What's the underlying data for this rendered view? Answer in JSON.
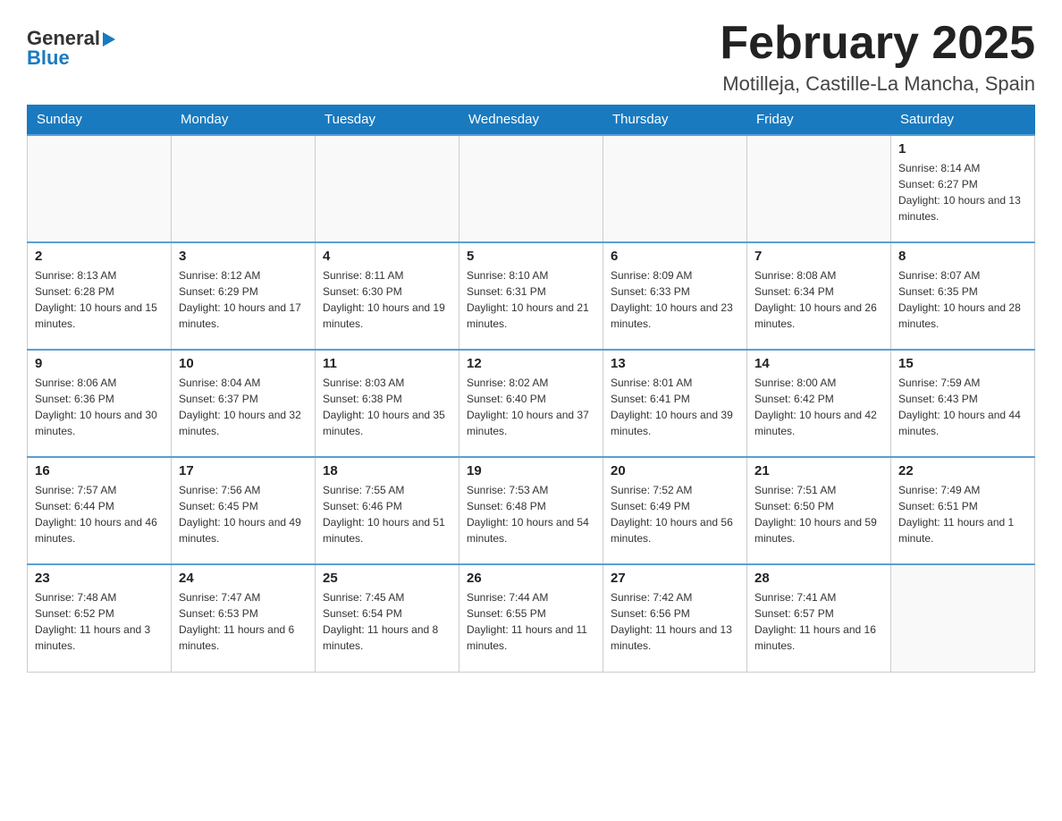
{
  "header": {
    "logo_text_general": "General",
    "logo_text_blue": "Blue",
    "month_title": "February 2025",
    "location": "Motilleja, Castille-La Mancha, Spain"
  },
  "calendar": {
    "days_of_week": [
      "Sunday",
      "Monday",
      "Tuesday",
      "Wednesday",
      "Thursday",
      "Friday",
      "Saturday"
    ],
    "weeks": [
      [
        {
          "day": "",
          "info": ""
        },
        {
          "day": "",
          "info": ""
        },
        {
          "day": "",
          "info": ""
        },
        {
          "day": "",
          "info": ""
        },
        {
          "day": "",
          "info": ""
        },
        {
          "day": "",
          "info": ""
        },
        {
          "day": "1",
          "info": "Sunrise: 8:14 AM\nSunset: 6:27 PM\nDaylight: 10 hours and 13 minutes."
        }
      ],
      [
        {
          "day": "2",
          "info": "Sunrise: 8:13 AM\nSunset: 6:28 PM\nDaylight: 10 hours and 15 minutes."
        },
        {
          "day": "3",
          "info": "Sunrise: 8:12 AM\nSunset: 6:29 PM\nDaylight: 10 hours and 17 minutes."
        },
        {
          "day": "4",
          "info": "Sunrise: 8:11 AM\nSunset: 6:30 PM\nDaylight: 10 hours and 19 minutes."
        },
        {
          "day": "5",
          "info": "Sunrise: 8:10 AM\nSunset: 6:31 PM\nDaylight: 10 hours and 21 minutes."
        },
        {
          "day": "6",
          "info": "Sunrise: 8:09 AM\nSunset: 6:33 PM\nDaylight: 10 hours and 23 minutes."
        },
        {
          "day": "7",
          "info": "Sunrise: 8:08 AM\nSunset: 6:34 PM\nDaylight: 10 hours and 26 minutes."
        },
        {
          "day": "8",
          "info": "Sunrise: 8:07 AM\nSunset: 6:35 PM\nDaylight: 10 hours and 28 minutes."
        }
      ],
      [
        {
          "day": "9",
          "info": "Sunrise: 8:06 AM\nSunset: 6:36 PM\nDaylight: 10 hours and 30 minutes."
        },
        {
          "day": "10",
          "info": "Sunrise: 8:04 AM\nSunset: 6:37 PM\nDaylight: 10 hours and 32 minutes."
        },
        {
          "day": "11",
          "info": "Sunrise: 8:03 AM\nSunset: 6:38 PM\nDaylight: 10 hours and 35 minutes."
        },
        {
          "day": "12",
          "info": "Sunrise: 8:02 AM\nSunset: 6:40 PM\nDaylight: 10 hours and 37 minutes."
        },
        {
          "day": "13",
          "info": "Sunrise: 8:01 AM\nSunset: 6:41 PM\nDaylight: 10 hours and 39 minutes."
        },
        {
          "day": "14",
          "info": "Sunrise: 8:00 AM\nSunset: 6:42 PM\nDaylight: 10 hours and 42 minutes."
        },
        {
          "day": "15",
          "info": "Sunrise: 7:59 AM\nSunset: 6:43 PM\nDaylight: 10 hours and 44 minutes."
        }
      ],
      [
        {
          "day": "16",
          "info": "Sunrise: 7:57 AM\nSunset: 6:44 PM\nDaylight: 10 hours and 46 minutes."
        },
        {
          "day": "17",
          "info": "Sunrise: 7:56 AM\nSunset: 6:45 PM\nDaylight: 10 hours and 49 minutes."
        },
        {
          "day": "18",
          "info": "Sunrise: 7:55 AM\nSunset: 6:46 PM\nDaylight: 10 hours and 51 minutes."
        },
        {
          "day": "19",
          "info": "Sunrise: 7:53 AM\nSunset: 6:48 PM\nDaylight: 10 hours and 54 minutes."
        },
        {
          "day": "20",
          "info": "Sunrise: 7:52 AM\nSunset: 6:49 PM\nDaylight: 10 hours and 56 minutes."
        },
        {
          "day": "21",
          "info": "Sunrise: 7:51 AM\nSunset: 6:50 PM\nDaylight: 10 hours and 59 minutes."
        },
        {
          "day": "22",
          "info": "Sunrise: 7:49 AM\nSunset: 6:51 PM\nDaylight: 11 hours and 1 minute."
        }
      ],
      [
        {
          "day": "23",
          "info": "Sunrise: 7:48 AM\nSunset: 6:52 PM\nDaylight: 11 hours and 3 minutes."
        },
        {
          "day": "24",
          "info": "Sunrise: 7:47 AM\nSunset: 6:53 PM\nDaylight: 11 hours and 6 minutes."
        },
        {
          "day": "25",
          "info": "Sunrise: 7:45 AM\nSunset: 6:54 PM\nDaylight: 11 hours and 8 minutes."
        },
        {
          "day": "26",
          "info": "Sunrise: 7:44 AM\nSunset: 6:55 PM\nDaylight: 11 hours and 11 minutes."
        },
        {
          "day": "27",
          "info": "Sunrise: 7:42 AM\nSunset: 6:56 PM\nDaylight: 11 hours and 13 minutes."
        },
        {
          "day": "28",
          "info": "Sunrise: 7:41 AM\nSunset: 6:57 PM\nDaylight: 11 hours and 16 minutes."
        },
        {
          "day": "",
          "info": ""
        }
      ]
    ]
  }
}
